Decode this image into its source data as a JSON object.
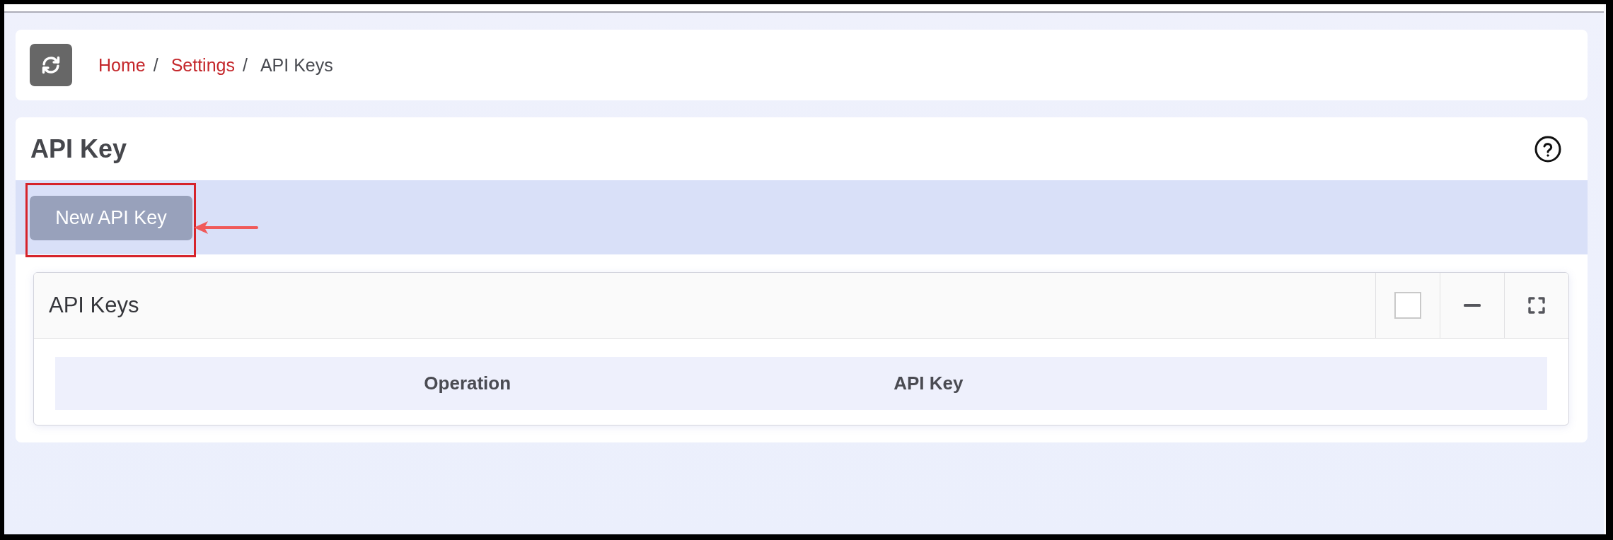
{
  "breadcrumb": {
    "items": [
      {
        "label": "Home",
        "kind": "link",
        "separator": "/"
      },
      {
        "label": "Settings",
        "kind": "link",
        "separator": "/"
      },
      {
        "label": "API Keys",
        "kind": "current"
      }
    ]
  },
  "page": {
    "title": "API Key"
  },
  "toolbar": {
    "buttons": [
      {
        "label": "New API Key"
      }
    ]
  },
  "panel": {
    "title": "API Keys",
    "checkbox": {
      "checked": false
    },
    "table": {
      "columns": [
        "Operation",
        "API Key"
      ]
    }
  }
}
